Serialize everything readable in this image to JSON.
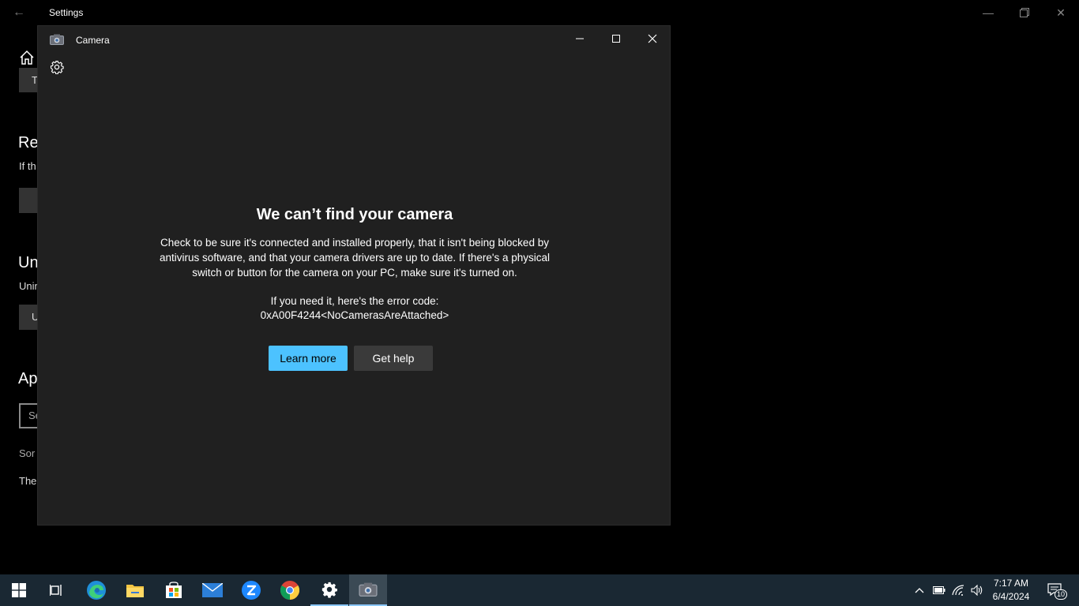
{
  "settings": {
    "title": "Settings",
    "btn1": "Te",
    "heading1": "Res",
    "text1": "If th",
    "heading2": "Un",
    "text2": "Unin",
    "btn3": "U",
    "heading3": "Ap",
    "search_placeholder": "Se",
    "sort_text": "Sor",
    "bottom_text": "The"
  },
  "camera": {
    "title": "Camera",
    "heading": "We can’t find your camera",
    "description": "Check to be sure it's connected and installed properly, that it isn't being blocked by antivirus software, and that your camera drivers are up to date. If there's a physical switch or button for the camera on your PC, make sure it's turned on.",
    "error_intro": "If you need it, here's the error code:",
    "error_code": "0xA00F4244<NoCamerasAreAttached>",
    "learn_more": "Learn more",
    "get_help": "Get help"
  },
  "taskbar": {
    "time": "7:17 AM",
    "date": "6/4/2024",
    "notification_count": "10"
  },
  "colors": {
    "accent": "#4cc2ff",
    "window_bg": "#202020",
    "taskbar_bg": "#1a2833"
  }
}
